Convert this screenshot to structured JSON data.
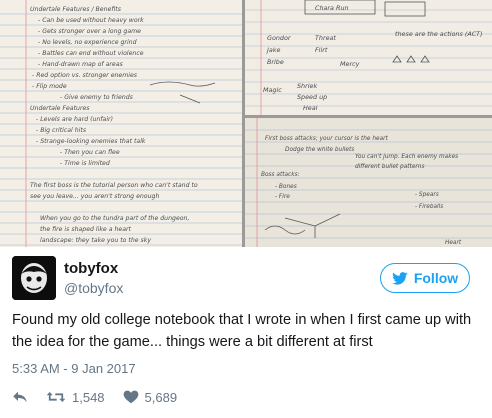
{
  "notebook": {
    "p1": {
      "title": "Undertale Features / Benefits",
      "lines": [
        "- Can be used without heavy work",
        "- Gets stronger over a long game",
        "- No levels, no experience grind",
        "- Battles can end without violence",
        "- Hand-drawn map of areas",
        "- Red option vs. stronger enemies",
        "- Flip mode",
        "- Give enemy to friends"
      ],
      "heading2": "Undertale Features",
      "lines2": [
        "- Levels are hard (unfair)",
        "- Big critical hits",
        "- Strange-looking enemies that talk",
        "- Then you can flee",
        "- Time is limited"
      ],
      "bottom": [
        "The first boss is the tutorial person who can't stand to",
        "see you leave... you aren't strong enough",
        "",
        "When you go to the tundra part of the dungeon,",
        "the fire is shaped like a heart",
        "landscape: they take you to the sky"
      ]
    },
    "p2": {
      "tab": "Chara  Run",
      "list": [
        "Gondor",
        "Jake",
        "Bribe"
      ],
      "list_b": [
        "Threat",
        "Flirt",
        "Mercy"
      ],
      "magic": [
        "Magic",
        "Shriek",
        "Speed up",
        "Heal"
      ],
      "side": "these are the actions (ACT)"
    },
    "p3": {
      "lines": [
        "First boss attacks; your cursor is the heart",
        "Dodge the white bullets",
        "You can't jump. Each enemy makes",
        "different bullet patterns",
        "Boss attacks:",
        "- Bones",
        "- Fire",
        "- Spears",
        "- Fireballs",
        "Heart"
      ]
    }
  },
  "tweet": {
    "display_name": "tobyfox",
    "handle": "@tobyfox",
    "follow_label": "Follow",
    "text": "Found my old college notebook that I wrote in when I first came up with the idea for the game... things were a bit different at first",
    "timestamp": "5:33 AM - 9 Jan 2017",
    "retweets": "1,548",
    "likes": "5,689"
  },
  "colors": {
    "twitter_blue": "#1da1f2",
    "secondary_text": "#657786",
    "primary_text": "#14171a"
  },
  "icons": [
    "twitter-bird-icon",
    "reply-icon",
    "retweet-icon",
    "heart-icon"
  ]
}
